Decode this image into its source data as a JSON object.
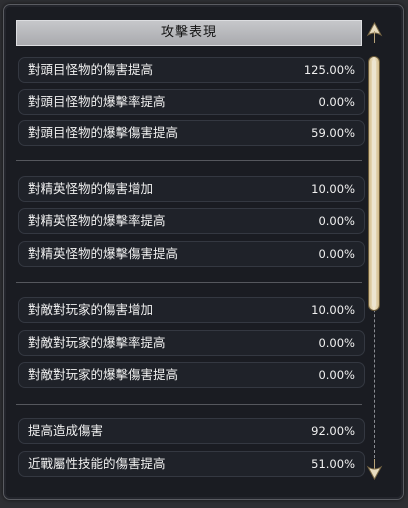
{
  "panel": {
    "title": "攻擊表現"
  },
  "groups": [
    {
      "rows": [
        {
          "label": "對頭目怪物的傷害提高",
          "value": "125.00%"
        },
        {
          "label": "對頭目怪物的爆擊率提高",
          "value": "0.00%"
        },
        {
          "label": "對頭目怪物的爆擊傷害提高",
          "value": "59.00%"
        }
      ]
    },
    {
      "rows": [
        {
          "label": "對精英怪物的傷害增加",
          "value": "10.00%"
        },
        {
          "label": "對精英怪物的爆擊率提高",
          "value": "0.00%"
        },
        {
          "label": "對精英怪物的爆擊傷害提高",
          "value": "0.00%"
        }
      ]
    },
    {
      "rows": [
        {
          "label": "對敵對玩家的傷害增加",
          "value": "10.00%"
        },
        {
          "label": "對敵對玩家的爆擊率提高",
          "value": "0.00%"
        },
        {
          "label": "對敵對玩家的爆擊傷害提高",
          "value": "0.00%"
        }
      ]
    },
    {
      "rows": [
        {
          "label": "提高造成傷害",
          "value": "92.00%"
        },
        {
          "label": "近戰屬性技能的傷害提高",
          "value": "51.00%"
        }
      ]
    }
  ],
  "scrollbar": {
    "up_icon": "arrow-up-icon",
    "down_icon": "arrow-down-icon",
    "position": 0.0
  },
  "colors": {
    "panel_bg": "#1a1c22",
    "row_bg": "#1f2229",
    "title_bar": "#b8b9bc",
    "scroll_thumb": "#e8dcc0"
  }
}
